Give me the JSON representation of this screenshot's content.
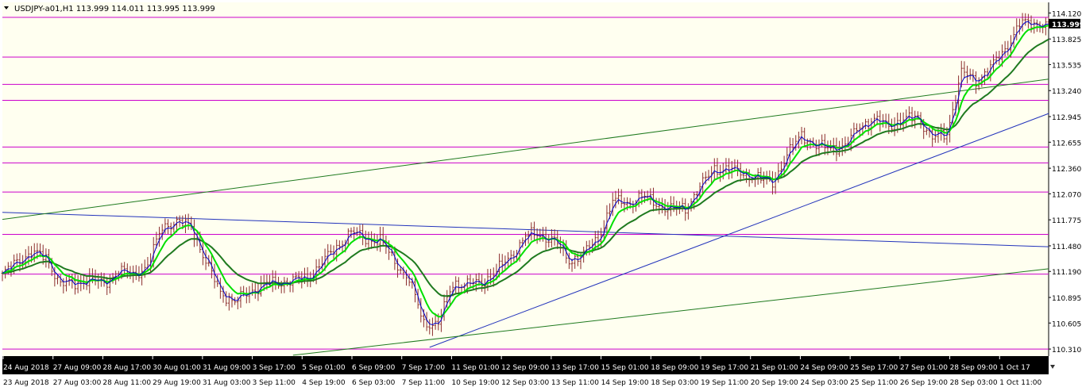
{
  "window": {
    "header": "USDJPY-a01,H1  113.999 114.011 113.995 113.999",
    "menu_icon": "triangle-down-icon"
  },
  "colors": {
    "background": "#fffff0",
    "candles": "#8b2d2d",
    "ma_fast": "#00e000",
    "ma_mid": "#0000cc",
    "ma_slow": "#1f7a1f",
    "horizontal_levels": "#cc00cc",
    "trend_blue": "#2233bb",
    "trend_green": "#1f7a1f",
    "bid_label_bg": "#000000",
    "time_axis_bg": "#000000"
  },
  "chart_data": {
    "type": "line",
    "title": "USDJPY-a01,H1",
    "symbol": "USDJPY-a01",
    "timeframe": "H1",
    "ohlc_header": {
      "open": 113.999,
      "high": 114.011,
      "low": 113.995,
      "close": 113.999
    },
    "current_price": "113.999",
    "ylim": [
      110.23,
      114.24
    ],
    "y_ticks": [
      "114.120",
      "113.825",
      "113.535",
      "113.240",
      "112.945",
      "112.655",
      "112.360",
      "112.070",
      "111.775",
      "111.480",
      "111.190",
      "110.895",
      "110.605",
      "110.310"
    ],
    "x_ticks_top": [
      "24 Aug 2018",
      "27 Aug 09:00",
      "28 Aug 17:00",
      "30 Aug 01:00",
      "31 Aug 09:00",
      "3 Sep 17:00",
      "5 Sep 01:00",
      "6 Sep 09:00",
      "7 Sep 17:00",
      "11 Sep 01:00",
      "12 Sep 09:00",
      "13 Sep 17:00",
      "15 Sep 01:00",
      "18 Sep 09:00",
      "19 Sep 17:00",
      "21 Sep 01:00",
      "24 Sep 09:00",
      "25 Sep 17:00",
      "27 Sep 01:00",
      "28 Sep 09:00",
      "1 Oct 17"
    ],
    "x_ticks_bottom": [
      "23 Aug 2018",
      "27 Aug 03:00",
      "28 Aug 11:00",
      "29 Aug 19:00",
      "31 Aug 03:00",
      "3 Sep 11:00",
      "4 Sep 19:00",
      "6 Sep 03:00",
      "7 Sep 11:00",
      "10 Sep 19:00",
      "12 Sep 03:00",
      "13 Sep 11:00",
      "14 Sep 19:00",
      "18 Sep 03:00",
      "19 Sep 11:00",
      "20 Sep 19:00",
      "24 Sep 03:00",
      "25 Sep 11:00",
      "26 Sep 19:00",
      "28 Sep 03:00",
      "1 Oct 11:00"
    ],
    "horizontal_levels": [
      114.07,
      113.62,
      113.31,
      113.13,
      112.6,
      112.42,
      112.09,
      111.61,
      111.16,
      110.31
    ],
    "price_path": [
      [
        0,
        111.15
      ],
      [
        5,
        111.3
      ],
      [
        10,
        111.4
      ],
      [
        15,
        111.35
      ],
      [
        20,
        111.05
      ],
      [
        25,
        111.05
      ],
      [
        30,
        111.1
      ],
      [
        35,
        111.05
      ],
      [
        40,
        111.2
      ],
      [
        45,
        111.15
      ],
      [
        50,
        111.25
      ],
      [
        55,
        111.7
      ],
      [
        60,
        111.75
      ],
      [
        65,
        111.7
      ],
      [
        70,
        111.3
      ],
      [
        75,
        110.95
      ],
      [
        80,
        110.85
      ],
      [
        85,
        110.95
      ],
      [
        90,
        111.05
      ],
      [
        95,
        111.05
      ],
      [
        100,
        111.1
      ],
      [
        105,
        111.1
      ],
      [
        110,
        111.3
      ],
      [
        115,
        111.45
      ],
      [
        120,
        111.65
      ],
      [
        125,
        111.55
      ],
      [
        130,
        111.55
      ],
      [
        135,
        111.3
      ],
      [
        140,
        111.1
      ],
      [
        145,
        110.6
      ],
      [
        150,
        110.6
      ],
      [
        155,
        111.05
      ],
      [
        160,
        111.05
      ],
      [
        165,
        111.05
      ],
      [
        170,
        111.2
      ],
      [
        175,
        111.35
      ],
      [
        180,
        111.6
      ],
      [
        185,
        111.6
      ],
      [
        190,
        111.55
      ],
      [
        195,
        111.3
      ],
      [
        200,
        111.4
      ],
      [
        205,
        111.55
      ],
      [
        210,
        112.0
      ],
      [
        215,
        111.95
      ],
      [
        220,
        112.05
      ],
      [
        225,
        111.95
      ],
      [
        230,
        111.9
      ],
      [
        235,
        111.9
      ],
      [
        240,
        112.15
      ],
      [
        245,
        112.35
      ],
      [
        250,
        112.35
      ],
      [
        255,
        112.3
      ],
      [
        260,
        112.25
      ],
      [
        265,
        112.2
      ],
      [
        270,
        112.5
      ],
      [
        275,
        112.75
      ],
      [
        280,
        112.6
      ],
      [
        285,
        112.6
      ],
      [
        290,
        112.6
      ],
      [
        295,
        112.85
      ],
      [
        300,
        112.9
      ],
      [
        305,
        112.85
      ],
      [
        310,
        112.9
      ],
      [
        315,
        112.95
      ],
      [
        320,
        112.7
      ],
      [
        325,
        112.75
      ],
      [
        330,
        113.45
      ],
      [
        335,
        113.35
      ],
      [
        340,
        113.5
      ],
      [
        345,
        113.7
      ],
      [
        350,
        114.0
      ],
      [
        355,
        114.0
      ],
      [
        360,
        113.999
      ]
    ],
    "moving_averages": [
      {
        "color": "#00e000",
        "period": 8
      },
      {
        "color": "#0000cc",
        "period": 3
      },
      {
        "color": "#1f7a1f",
        "period": 22
      }
    ],
    "trend_lines": [
      {
        "color": "#2233bb",
        "from": [
          0,
          111.86
        ],
        "to": [
          360,
          111.47
        ]
      },
      {
        "color": "#2233bb",
        "from": [
          147,
          110.33
        ],
        "to": [
          360,
          112.98
        ]
      },
      {
        "color": "#1f7a1f",
        "from": [
          0,
          111.78
        ],
        "to": [
          360,
          113.37
        ]
      },
      {
        "color": "#1f7a1f",
        "from": [
          100,
          110.24
        ],
        "to": [
          360,
          111.22
        ]
      }
    ]
  }
}
